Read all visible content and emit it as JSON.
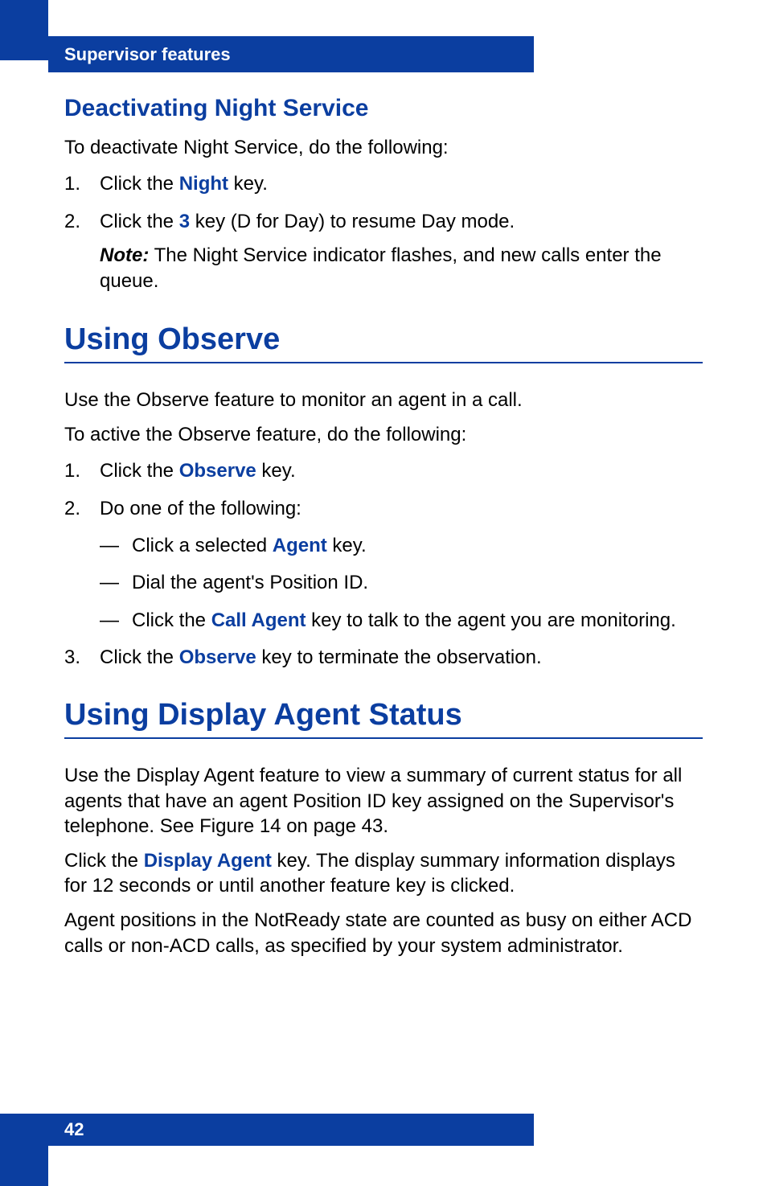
{
  "header": {
    "section_title": "Supervisor features"
  },
  "s1": {
    "heading": "Deactivating Night Service",
    "intro": "To deactivate Night Service, do the following:",
    "steps": {
      "one": {
        "pre": "Click the ",
        "kw": "Night",
        "post": " key."
      },
      "two": {
        "pre": "Click the ",
        "kw": "3",
        "post": " key (D for Day) to resume Day mode."
      },
      "note_label": "Note:",
      "note_text": " The Night Service indicator flashes, and new calls enter the queue."
    }
  },
  "s2": {
    "heading": "Using Observe",
    "p1": "Use the Observe feature to monitor an agent in a call.",
    "p2": "To active the Observe feature, do the following:",
    "steps": {
      "one": {
        "pre": "Click the ",
        "kw": "Observe",
        "post": " key."
      },
      "two": {
        "label": "Do one of the following:",
        "a": {
          "pre": "Click a selected ",
          "kw": "Agent",
          "post": " key."
        },
        "b": "Dial the agent's Position ID.",
        "c": {
          "pre": "Click the ",
          "kw": "Call Agent",
          "post": " key to talk to the agent you are monitoring."
        }
      },
      "three": {
        "pre": "Click the ",
        "kw": "Observe",
        "post": " key to terminate the observation."
      }
    }
  },
  "s3": {
    "heading": "Using Display Agent Status",
    "p1": "Use the Display Agent feature to view a summary of current status for all agents that have an agent Position ID key assigned on the Supervisor's telephone. See Figure 14 on page 43.",
    "p2": {
      "pre": "Click the ",
      "kw": "Display Agent",
      "post": " key. The display summary information displays for 12 seconds or until another feature key is clicked."
    },
    "p3": "Agent positions in the NotReady state are counted as busy on either ACD calls or non-ACD calls, as specified by your system administrator."
  },
  "footer": {
    "page_number": "42"
  }
}
